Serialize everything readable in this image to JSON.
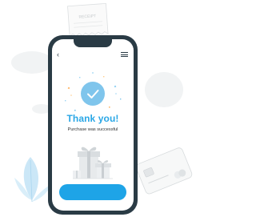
{
  "purchase": {
    "title": "Thank you!",
    "message": "Purchase was successful"
  },
  "receipt": {
    "label": "RECEIPT"
  },
  "colors": {
    "accent": "#1ea4e7",
    "title": "#2aa7e6",
    "check_circle": "#7fc5ec",
    "phone_frame": "#2a3b45"
  },
  "icons": {
    "back": "chevron-left-icon",
    "menu": "hamburger-menu-icon",
    "success": "checkmark-icon",
    "gift": "gift-boxes-icon",
    "card": "credit-card-icon",
    "plant": "leaf-plant-icon",
    "receipt": "receipt-icon"
  }
}
